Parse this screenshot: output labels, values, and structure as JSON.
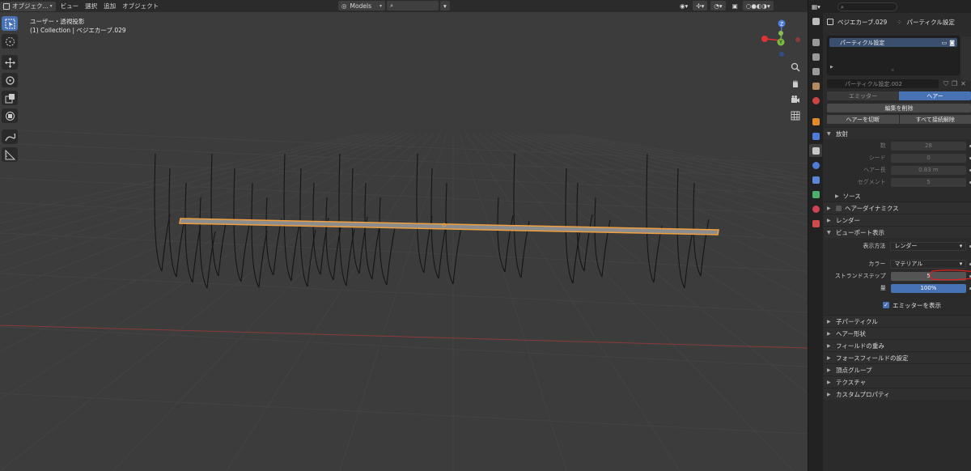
{
  "header": {
    "mode": "オブジェク...",
    "menus": [
      "ビュー",
      "選択",
      "追加",
      "オブジェクト"
    ],
    "collection_selector": "Models"
  },
  "viewport": {
    "view_name": "ユーザー・透視投影",
    "object_info": "(1) Collection | ベジエカーブ.029",
    "gizmo": {
      "z": "Z",
      "y": "Y",
      "x": "X"
    }
  },
  "properties": {
    "context_object": "ベジエカーブ.029",
    "context_tab": "パーティクル設定",
    "system_list": [
      "パーティクル設定"
    ],
    "datablock": "パーティクル設定.002",
    "type_options": [
      "エミッター",
      "ヘアー"
    ],
    "active_type": "ヘアー",
    "edit_delete_label": "編集を削除",
    "cut_hair_label": "ヘアーを切断",
    "disconnect_all_label": "すべて接続解除",
    "emission": {
      "title": "放射",
      "fields": [
        {
          "label": "数",
          "value": "28"
        },
        {
          "label": "シード",
          "value": "0"
        },
        {
          "label": "ヘアー長",
          "value": "0.83 m"
        },
        {
          "label": "セグメント",
          "value": "5"
        }
      ],
      "source_label": "ソース"
    },
    "hair_dynamics_label": "ヘアーダイナミクス",
    "render_label": "レンダー",
    "viewport_display": {
      "title": "ビューポート表示",
      "display_as_label": "表示方法",
      "display_as_value": "レンダー",
      "color_label": "カラー",
      "color_value": "マテリアル",
      "strand_steps_label": "ストランドステップ",
      "strand_steps_value": "5",
      "amount_label": "量",
      "amount_value": "100%",
      "show_emitter_label": "エミッターを表示"
    },
    "collapsed_panels": [
      "子パーティクル",
      "ヘアー形状",
      "フィールドの重み",
      "フォースフィールドの設定",
      "頂点グループ",
      "テクスチャ",
      "カスタムプロパティ"
    ]
  },
  "colors": {
    "accent": "#4772b3",
    "selection_outline": "#f0a040",
    "annotation": "#e0201e"
  }
}
